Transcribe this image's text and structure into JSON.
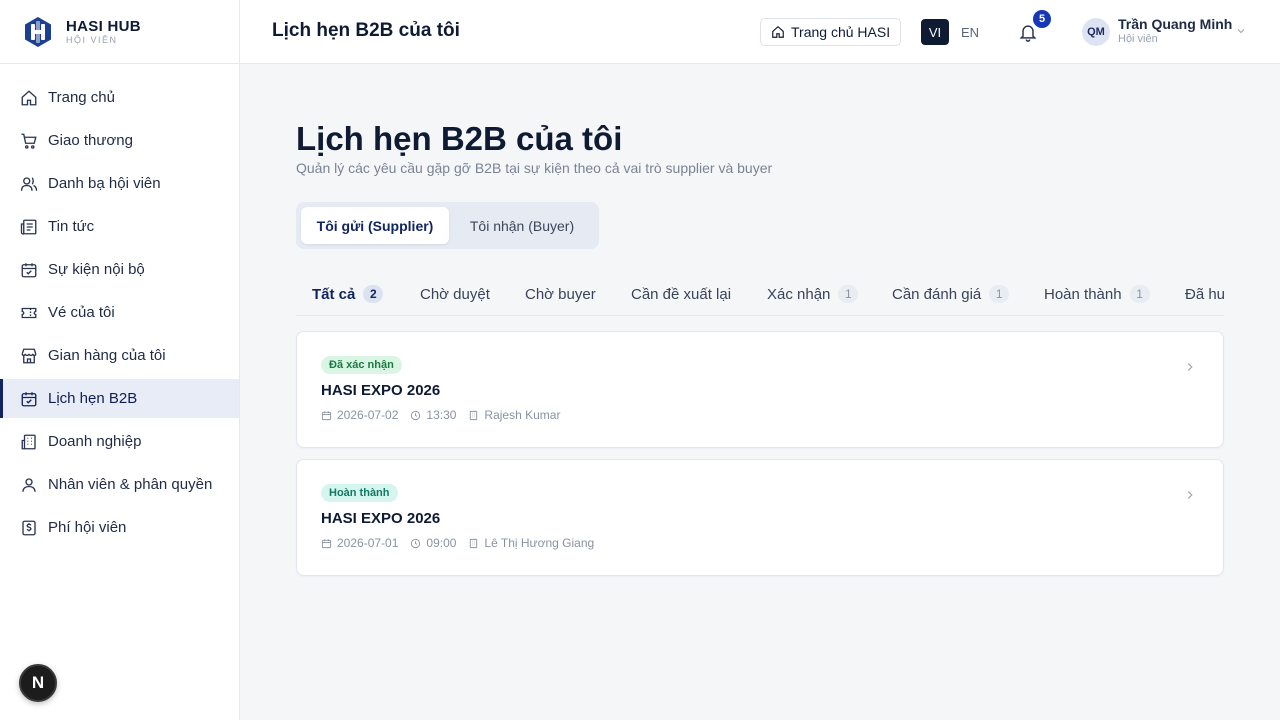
{
  "brand": {
    "name": "HASI HUB",
    "sub": "HỘI VIÊN"
  },
  "sidebar": {
    "items": [
      {
        "label": "Trang chủ",
        "icon": "home-icon"
      },
      {
        "label": "Giao thương",
        "icon": "cart-icon"
      },
      {
        "label": "Danh bạ hội viên",
        "icon": "users-icon"
      },
      {
        "label": "Tin tức",
        "icon": "newspaper-icon"
      },
      {
        "label": "Sự kiện nội bộ",
        "icon": "calendar-icon"
      },
      {
        "label": "Vé của tôi",
        "icon": "ticket-icon"
      },
      {
        "label": "Gian hàng của tôi",
        "icon": "store-icon"
      },
      {
        "label": "Lịch hẹn B2B",
        "icon": "calendar-check-icon",
        "active": true
      },
      {
        "label": "Doanh nghiệp",
        "icon": "building-icon"
      },
      {
        "label": "Nhân viên & phân quyền",
        "icon": "user-icon"
      },
      {
        "label": "Phí hội viên",
        "icon": "fee-icon"
      }
    ],
    "dev_badge": "N"
  },
  "header": {
    "title": "Lịch hẹn B2B của tôi",
    "home_button": "Trang chủ HASI",
    "lang_vi": "VI",
    "lang_en": "EN",
    "notifications": "5",
    "user": {
      "initials": "QM",
      "name": "Trần Quang Minh",
      "role": "Hội viên"
    }
  },
  "main": {
    "title": "Lịch hẹn B2B của tôi",
    "subtitle": "Quản lý các yêu cầu gặp gỡ B2B tại sự kiện theo cả vai trò supplier và buyer",
    "roles": {
      "selected": "Tôi gửi (Supplier)",
      "other": "Tôi nhận (Buyer)"
    },
    "tabs": [
      {
        "label": "Tất cả",
        "count": "2"
      },
      {
        "label": "Chờ duyệt",
        "count": ""
      },
      {
        "label": "Chờ buyer",
        "count": ""
      },
      {
        "label": "Cần đề xuất lại",
        "count": ""
      },
      {
        "label": "Xác nhận",
        "count": "1"
      },
      {
        "label": "Cần đánh giá",
        "count": "1"
      },
      {
        "label": "Hoàn thành",
        "count": "1"
      },
      {
        "label": "Đã hu",
        "count": ""
      }
    ],
    "appointments": [
      {
        "status": "Đã xác nhận",
        "event": "HASI EXPO 2026",
        "date": "2026-07-02",
        "time": "13:30",
        "partner": "Rajesh Kumar"
      },
      {
        "status": "Hoàn thành",
        "event": "HASI EXPO 2026",
        "date": "2026-07-01",
        "time": "09:00",
        "partner": "Lê Thị Hương Giang"
      }
    ]
  },
  "colors": {
    "accent": "#10245f",
    "badge_blue": "#1537b8",
    "confirmed": "#1d7a43",
    "done": "#127a62"
  }
}
